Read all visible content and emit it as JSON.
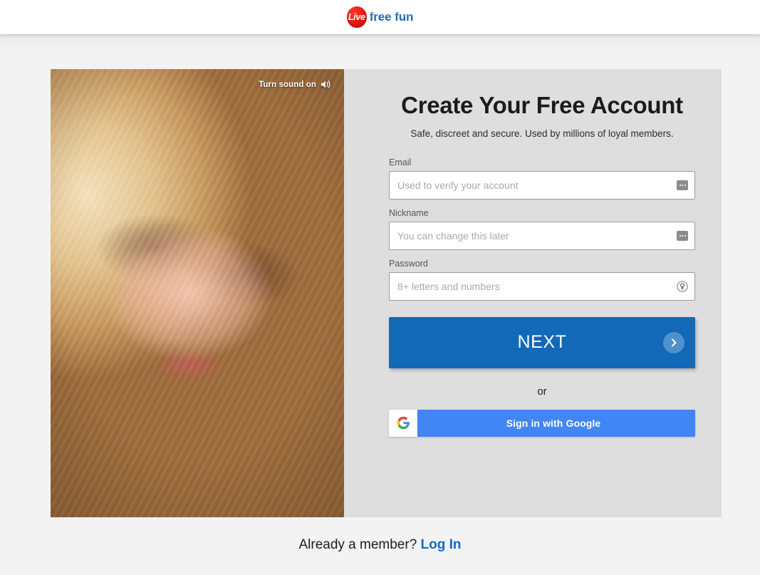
{
  "header": {
    "logo": {
      "badge_text": "Live",
      "word_text": "free fun",
      "badge_color": "#ef1d14",
      "word_color": "#1565b8"
    }
  },
  "media": {
    "sound_toggle_label": "Turn sound on",
    "sound_icon": "speaker-icon"
  },
  "form": {
    "title": "Create Your Free Account",
    "subtitle": "Safe, discreet and secure. Used by millions of loyal members.",
    "fields": [
      {
        "label": "Email",
        "placeholder": "Used to verify your account",
        "value": "",
        "icon": "autofill-icon"
      },
      {
        "label": "Nickname",
        "placeholder": "You can change this later",
        "value": "",
        "icon": "autofill-icon"
      },
      {
        "label": "Password",
        "placeholder": "8+ letters and numbers",
        "value": "",
        "icon": "key-icon"
      }
    ],
    "next_button": {
      "label": "NEXT",
      "icon": "chevron-right-icon",
      "color": "#1169b8"
    },
    "divider_text": "or",
    "google_button": {
      "label": "Sign in with Google",
      "icon": "google-g-icon",
      "color": "#4285f4"
    }
  },
  "footer": {
    "prompt": "Already a member?",
    "link_label": "Log In",
    "link_color": "#1168c9"
  }
}
